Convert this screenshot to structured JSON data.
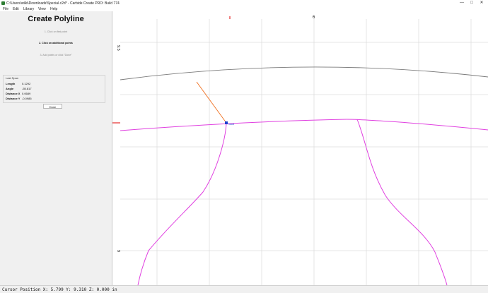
{
  "window": {
    "title": "C:\\Users\\wilki\\Downloads\\Special.c2d* - Carbide Create PRO: Build 774",
    "controls": {
      "minimize": "—",
      "maximize": "□",
      "close": "✕"
    }
  },
  "menu": [
    "File",
    "Edit",
    "Library",
    "View",
    "Help"
  ],
  "panel": {
    "title": "Create Polyline",
    "steps": [
      "1. Click on first point",
      "2. Click on additional points",
      "3. Add points or click \"Done\""
    ],
    "active_step": 1,
    "last_span": {
      "title": "Last Span",
      "rows": [
        {
          "label": "Length",
          "value": "0.1292"
        },
        {
          "label": "Angle",
          "value": "-55.817"
        },
        {
          "label": "Distance X",
          "value": "0.0689"
        },
        {
          "label": "Distance Y",
          "value": "-0.0985"
        }
      ]
    },
    "done_label": "Done"
  },
  "rulers": {
    "top_label": "6",
    "left_labels": [
      "9.5",
      "9"
    ]
  },
  "canvas": {
    "point_label": "Node"
  },
  "colors": {
    "path_magenta": "#e040e0",
    "path_gray": "#7a7a7a",
    "rubber_band": "#f07020",
    "node_blue": "#1a3fd0",
    "grid": "#dcdcdc",
    "ruler_marker": "#e00000"
  },
  "status": {
    "text": "Cursor Position X: 5.799 Y: 9.310 Z: 0.000 in"
  }
}
